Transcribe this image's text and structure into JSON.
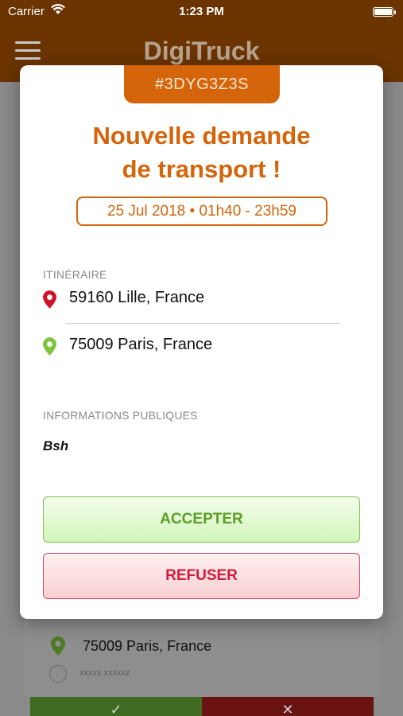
{
  "status_bar": {
    "carrier": "Carrier",
    "time": "1:23 PM"
  },
  "nav": {
    "title": "DigiTruck"
  },
  "background_card": {
    "address": "75009 Paris, France",
    "user_name": "xxxxx xxxxxz"
  },
  "modal": {
    "reference": "#3DYG3Z3S",
    "title_line1": "Nouvelle demande",
    "title_line2": "de transport !",
    "date_range": "25 Jul 2018 • 01h40 - 23h59",
    "itinerary_label": "ITINÉRAIRE",
    "origin": "59160 Lille, France",
    "destination": "75009 Paris, France",
    "public_info_label": "INFORMATIONS PUBLIQUES",
    "public_info": "Bsh",
    "accept_label": "ACCEPTER",
    "refuse_label": "REFUSER"
  },
  "colors": {
    "brand_brown": "#6b3400",
    "accent_orange": "#d4650b",
    "origin_pin": "#d1132a",
    "destination_pin": "#7cc43a",
    "accept_green": "#5aa024",
    "refuse_red": "#d11b3c"
  },
  "icons": {
    "menu": "hamburger-icon",
    "wifi": "wifi-icon",
    "battery": "battery-icon",
    "origin": "map-pin-icon",
    "destination": "map-pin-icon",
    "user": "user-icon"
  }
}
